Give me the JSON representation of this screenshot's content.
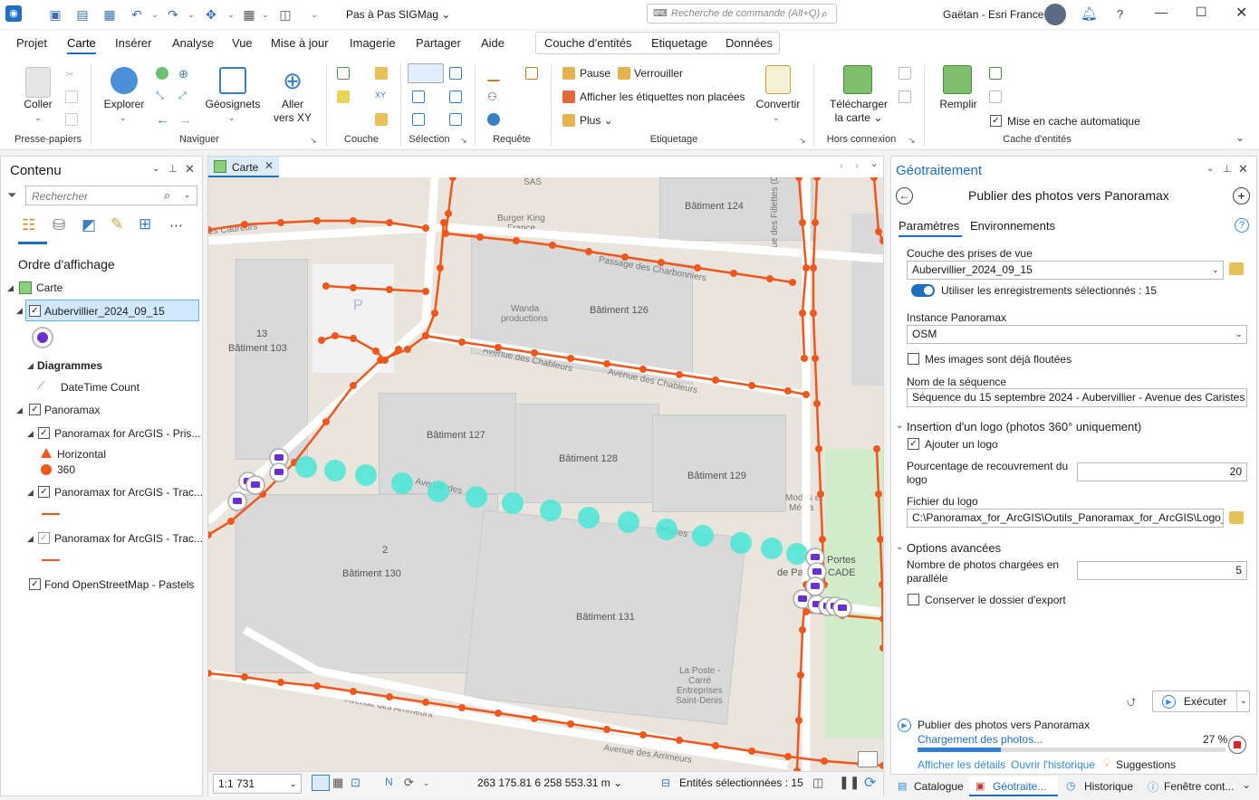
{
  "titlebar": {
    "project": "Pas à Pas SIGMag",
    "command_search_placeholder": "Recherche de commande (Alt+Q)",
    "user": "Gaëtan - Esri France",
    "help": "?"
  },
  "menu": {
    "items": [
      "Projet",
      "Carte",
      "Insérer",
      "Analyse",
      "Vue",
      "Mise à jour",
      "Imagerie",
      "Partager",
      "Aide"
    ],
    "context": [
      "Couche d'entités",
      "Etiquetage",
      "Données"
    ]
  },
  "ribbon": {
    "clipboard": {
      "paste": "Coller",
      "group": "Presse-papiers"
    },
    "navigate": {
      "explore": "Explorer",
      "bookmarks": "Géosignets",
      "goto_l1": "Aller",
      "goto_l2": "vers XY",
      "group": "Naviguer"
    },
    "layer": {
      "group": "Couche"
    },
    "selection": {
      "group": "Sélection"
    },
    "query": {
      "group": "Requête"
    },
    "labeling": {
      "pause": "Pause",
      "lock": "Verrouiller",
      "unplaced": "Afficher les étiquettes non placées",
      "more": "Plus",
      "convert": "Convertir",
      "group": "Etiquetage"
    },
    "offline": {
      "download_l1": "Télécharger",
      "download_l2": "la carte",
      "group": "Hors connexion"
    },
    "cache": {
      "fill": "Remplir",
      "auto": "Mise en cache automatique",
      "group": "Cache d'entités"
    }
  },
  "contents": {
    "title": "Contenu",
    "search_placeholder": "Rechercher",
    "drawing_order": "Ordre d'affichage",
    "items": {
      "map": "Carte",
      "layer1": "Aubervillier_2024_09_15",
      "diagrams": "Diagrammes",
      "datetime": "DateTime Count",
      "panoramax": "Panoramax",
      "pan1": "Panoramax for ArcGIS - Pris...",
      "horizontal": "Horizontal",
      "deg360": "360",
      "pan2": "Panoramax for ArcGIS - Trac...",
      "pan3": "Panoramax for ArcGIS - Trac...",
      "basemap": "Fond OpenStreetMap - Pastels"
    }
  },
  "map": {
    "tab": "Carte",
    "buildings": [
      "Bâtiment 124",
      "Bâtiment 126",
      "Bâtiment 103",
      "Bâtiment 127",
      "Bâtiment 128",
      "Bâtiment 129",
      "Bâtiment 130",
      "Bâtiment 131"
    ],
    "num13": "13",
    "num2": "2",
    "streets": [
      "es Cadreurs",
      "Passage des Charbonniers",
      "Avenue des Chableurs",
      "Avenue des Chableurs",
      "Avenue des Arrimeurs",
      "Avenue des Arrimeurs",
      "Rue des Fillettes (D20)",
      "Avenue des",
      "Artistes"
    ],
    "pois": {
      "sas": "SAS",
      "bk1": "Burger King",
      "bk2": "France",
      "wanda1": "Wanda",
      "wanda2": "productions",
      "parking": "P",
      "modes1": "Modes et",
      "modes2": "Média",
      "portes1": "Portes",
      "portes2": "de Paris",
      "cade": "CADE",
      "poste1": "La Poste -",
      "poste2": "Carré",
      "poste3": "Entreprises",
      "poste4": "Saint-Denis"
    },
    "scale": "1:1 731",
    "coords": "263 175.81 6 258 553.31 m",
    "selected": "Entités sélectionnées : 15"
  },
  "geo": {
    "title": "Géotraitement",
    "tool": "Publier des photos vers Panoramax",
    "tab_params": "Paramètres",
    "tab_env": "Environnements",
    "layer_label": "Couche des prises de vue",
    "layer_value": "Aubervillier_2024_09_15",
    "use_selected": "Utiliser les enregistrements sélectionnés : 15",
    "instance_label": "Instance Panoramax",
    "instance_value": "OSM",
    "blurred": "Mes images sont déjà floutées",
    "seq_label": "Nom de la séquence",
    "seq_value": "Séquence du 15 septembre 2024 - Aubervillier - Avenue des Caristes",
    "logo_section": "Insertion d'un logo (photos 360° uniquement)",
    "add_logo": "Ajouter un logo",
    "overlap_l1": "Pourcentage de recouvrement du",
    "overlap_l2": "logo",
    "overlap_value": "20",
    "logo_file_label": "Fichier du logo",
    "logo_file_value": "C:\\Panoramax_for_ArcGIS\\Outils_Panoramax_for_ArcGIS\\Logo_GI",
    "advanced": "Options avancées",
    "parallel_l1": "Nombre de photos chargées en",
    "parallel_l2": "parallèle",
    "parallel_value": "5",
    "keep_export": "Conserver le dossier d'export",
    "run": "Exécuter",
    "progress_title": "Publier des photos vers Panoramax",
    "progress_status": "Chargement des photos...",
    "progress_pct": "27 %",
    "progress": 0.27,
    "details": "Afficher les détails",
    "history": "Ouvrir l'historique",
    "suggestions": "Suggestions"
  },
  "bottom_tabs": [
    "Catalogue",
    "Géotraite...",
    "Historique",
    "Fenêtre cont..."
  ],
  "colors": {
    "accent": "#1f6fbf",
    "track": "#f0571c",
    "selected": "#49e6d6",
    "photo": "#6a2fd0",
    "progress": "#2f7fd6"
  }
}
